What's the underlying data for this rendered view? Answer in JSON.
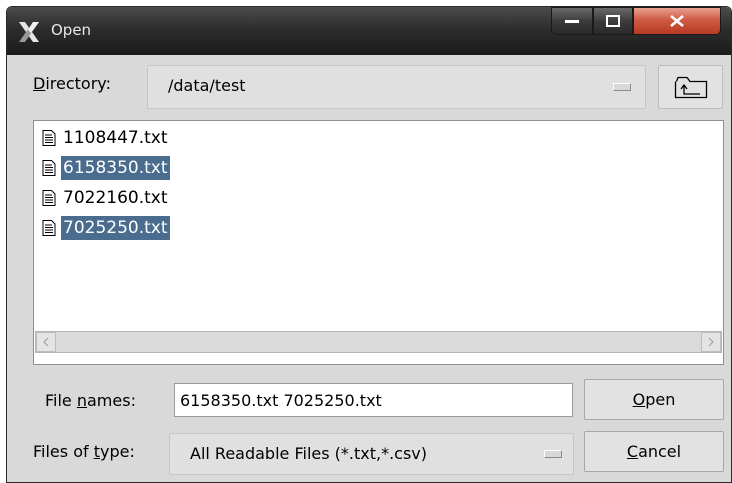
{
  "window": {
    "title": "Open",
    "controls": [
      "minimize-icon",
      "maximize-icon",
      "close-icon"
    ]
  },
  "directory": {
    "label_prefix": "",
    "label_mnemonic": "D",
    "label_rest": "irectory:",
    "value": "/data/test"
  },
  "files": [
    {
      "name": "1108447.txt",
      "selected": false
    },
    {
      "name": "6158350.txt",
      "selected": true
    },
    {
      "name": "7022160.txt",
      "selected": false
    },
    {
      "name": "7025250.txt",
      "selected": true
    }
  ],
  "file_names": {
    "label_prefix": "File ",
    "label_mnemonic": "n",
    "label_rest": "ames:",
    "value": "6158350.txt 7025250.txt"
  },
  "file_type": {
    "label_prefix": "Files of ",
    "label_mnemonic": "t",
    "label_rest": "ype:",
    "value": "All Readable Files (*.txt,*.csv)"
  },
  "buttons": {
    "open": {
      "mnemonic": "O",
      "rest": "pen"
    },
    "cancel": {
      "mnemonic": "C",
      "rest": "ancel"
    }
  },
  "colors": {
    "selection": "#4a6d8f",
    "titlebar": "#2d2d2d",
    "close_button": "#c8442e"
  }
}
